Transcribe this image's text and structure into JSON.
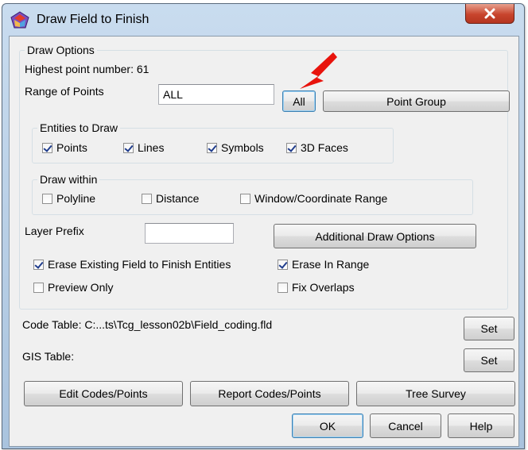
{
  "window": {
    "title": "Draw Field to Finish"
  },
  "draw_options": {
    "legend": "Draw Options",
    "highest_point": "Highest point number: 61",
    "range_label": "Range of Points",
    "range_value": "ALL",
    "all_button": "All",
    "point_group_button": "Point Group"
  },
  "entities": {
    "legend": "Entities to Draw",
    "items": [
      {
        "label": "Points",
        "checked": true
      },
      {
        "label": "Lines",
        "checked": true
      },
      {
        "label": "Symbols",
        "checked": true
      },
      {
        "label": "3D Faces",
        "checked": true
      }
    ]
  },
  "draw_within": {
    "legend": "Draw within",
    "items": [
      {
        "label": "Polyline",
        "checked": false
      },
      {
        "label": "Distance",
        "checked": false
      },
      {
        "label": "Window/Coordinate Range",
        "checked": false
      }
    ]
  },
  "layer": {
    "label": "Layer Prefix",
    "value": "",
    "additional_button": "Additional Draw Options"
  },
  "options": {
    "erase_existing": {
      "label": "Erase Existing Field to Finish Entities",
      "checked": true
    },
    "erase_in_range": {
      "label": "Erase In Range",
      "checked": true
    },
    "preview_only": {
      "label": "Preview Only",
      "checked": false
    },
    "fix_overlaps": {
      "label": "Fix Overlaps",
      "checked": false
    }
  },
  "code_table": {
    "label": "Code Table: C:...ts\\Tcg_lesson02b\\Field_coding.fld",
    "set_button": "Set"
  },
  "gis_table": {
    "label": "GIS Table:",
    "set_button": "Set"
  },
  "actions": {
    "edit_codes": "Edit Codes/Points",
    "report_codes": "Report Codes/Points",
    "tree_survey": "Tree Survey",
    "ok": "OK",
    "cancel": "Cancel",
    "help": "Help"
  },
  "colors": {
    "annotation_arrow": "#e8130c",
    "close_button": "#c8452d"
  },
  "icons": {
    "app": "survey-app-icon",
    "close": "close-icon",
    "arrow": "red-arrow-icon"
  }
}
